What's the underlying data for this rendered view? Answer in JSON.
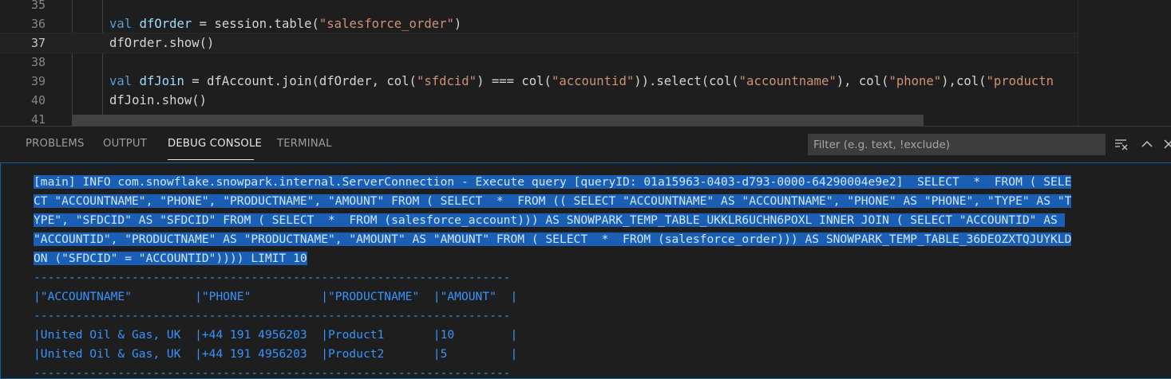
{
  "editor": {
    "lines": [
      {
        "num": "35"
      },
      {
        "num": "36",
        "tokens": [
          {
            "t": "val ",
            "c": "kw"
          },
          {
            "t": "dfOrder",
            "c": "var"
          },
          {
            "t": " = session.table(",
            "c": ""
          },
          {
            "t": "\"salesforce_order\"",
            "c": "str"
          },
          {
            "t": ")",
            "c": ""
          }
        ]
      },
      {
        "num": "37",
        "tokens": [
          {
            "t": "dfOrder.show()",
            "c": ""
          }
        ]
      },
      {
        "num": "38"
      },
      {
        "num": "39",
        "tokens": [
          {
            "t": "val ",
            "c": "kw"
          },
          {
            "t": "dfJoin",
            "c": "var"
          },
          {
            "t": " = dfAccount.join(dfOrder, col(",
            "c": ""
          },
          {
            "t": "\"sfdcid\"",
            "c": "str"
          },
          {
            "t": ") === col(",
            "c": ""
          },
          {
            "t": "\"accountid\"",
            "c": "str"
          },
          {
            "t": ")).select(col(",
            "c": ""
          },
          {
            "t": "\"accountname\"",
            "c": "str"
          },
          {
            "t": "), col(",
            "c": ""
          },
          {
            "t": "\"phone\"",
            "c": "str"
          },
          {
            "t": "),col(",
            "c": ""
          },
          {
            "t": "\"productn",
            "c": "str"
          }
        ]
      },
      {
        "num": "40",
        "tokens": [
          {
            "t": "dfJoin.show()",
            "c": ""
          }
        ]
      },
      {
        "num": "41"
      }
    ]
  },
  "panel": {
    "tabs": [
      "PROBLEMS",
      "OUTPUT",
      "DEBUG CONSOLE",
      "TERMINAL"
    ],
    "active_tab": "DEBUG CONSOLE",
    "filter_placeholder": "Filter (e.g. text, !exclude)",
    "icons": [
      "clear-console-icon",
      "collapse-panel-icon",
      "close-panel-icon"
    ]
  },
  "console": {
    "log_lines": [
      "[main] INFO com.snowflake.snowpark.internal.ServerConnection - Execute query [queryID: 01a15963-0403-d793-0000-64290004e9e2]  SELECT  *  FROM ( SELE",
      "CT \"ACCOUNTNAME\", \"PHONE\", \"PRODUCTNAME\", \"AMOUNT\" FROM ( SELECT  *  FROM (( SELECT \"ACCOUNTNAME\" AS \"ACCOUNTNAME\", \"PHONE\" AS \"PHONE\", \"TYPE\" AS \"T",
      "YPE\", \"SFDCID\" AS \"SFDCID\" FROM ( SELECT  *  FROM (salesforce_account))) AS SNOWPARK_TEMP_TABLE_UKKLR6UCHN6POXL INNER JOIN ( SELECT \"ACCOUNTID\" AS ",
      "\"ACCOUNTID\", \"PRODUCTNAME\" AS \"PRODUCTNAME\", \"AMOUNT\" AS \"AMOUNT\" FROM ( SELECT  *  FROM (salesforce_order))) AS SNOWPARK_TEMP_TABLE_36DEOZXTQJUYKLD",
      "ON (\"SFDCID\" = \"ACCOUNTID\")))) LIMIT 10"
    ],
    "table_lines": [
      "--------------------------------------------------------------------",
      "|\"ACCOUNTNAME\"         |\"PHONE\"          |\"PRODUCTNAME\"  |\"AMOUNT\"  |",
      "--------------------------------------------------------------------",
      "|United Oil & Gas, UK  |+44 191 4956203  |Product1       |10        |",
      "|United Oil & Gas, UK  |+44 191 4956203  |Product2       |5         |",
      "--------------------------------------------------------------------"
    ]
  },
  "colors": {
    "keyword": "#569cd6",
    "variable": "#9cdcfe",
    "string": "#ce9178",
    "console_text": "#4ea7e6",
    "selection": "#1a5fb4"
  }
}
